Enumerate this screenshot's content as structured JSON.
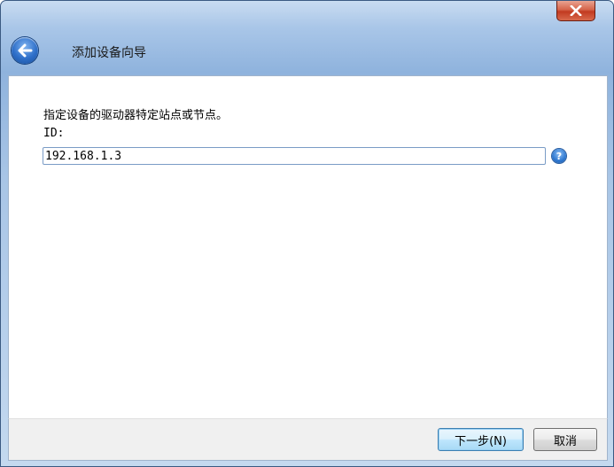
{
  "window": {
    "title": "添加设备向导",
    "close_icon": "close-icon",
    "back_icon": "back-arrow-icon"
  },
  "content": {
    "instruction": "指定设备的驱动器特定站点或节点。",
    "id_label": "ID:",
    "id_value": "192.168.1.3",
    "help_icon": "help-icon",
    "help_glyph": "?"
  },
  "footer": {
    "next_label": "下一步(N)",
    "cancel_label": "取消"
  },
  "colors": {
    "accent": "#3c7fb1",
    "close": "#c23a20"
  }
}
